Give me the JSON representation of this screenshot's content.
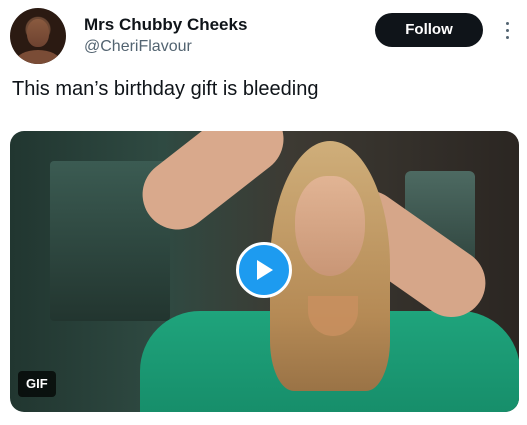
{
  "author": {
    "display_name": "Mrs Chubby Cheeks",
    "handle": "@CheriFlavour",
    "avatar_icon": "profile-photo"
  },
  "actions": {
    "follow_label": "Follow",
    "more_icon": "more-vertical-icon"
  },
  "tweet": {
    "text": "This man’s birthday gift is bleeding"
  },
  "media": {
    "type_badge": "GIF",
    "play_icon": "play-icon",
    "accent_color": "#1d9bf0"
  }
}
